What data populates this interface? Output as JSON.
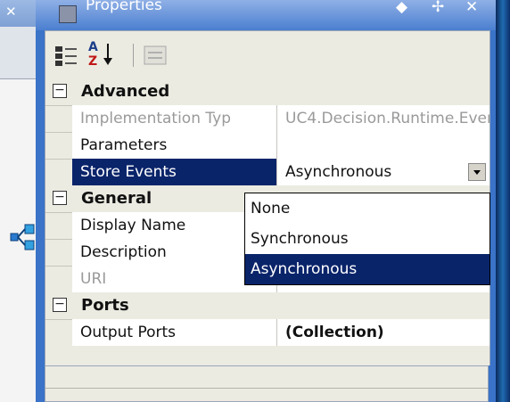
{
  "window": {
    "title": "Properties",
    "pin_glyph": "◆",
    "dock_glyph": "✢",
    "close_glyph": "✕"
  },
  "background_window": {
    "close_glyph": "✕"
  },
  "toolbar": {
    "sort_alpha_letters": [
      "A",
      "Z"
    ]
  },
  "categories": {
    "advanced": {
      "label": "Advanced",
      "expander": "⊟"
    },
    "general": {
      "label": "General",
      "expander": "⊟"
    },
    "ports": {
      "label": "Ports",
      "expander": "⊟"
    }
  },
  "properties": {
    "implementation_type": {
      "name": "Implementation Typ",
      "value": "UC4.Decision.Runtime.Ever"
    },
    "parameters": {
      "name": "Parameters",
      "value": ""
    },
    "store_events": {
      "name": "Store Events",
      "value": "Asynchronous"
    },
    "display_name": {
      "name": "Display Name",
      "value": ""
    },
    "description": {
      "name": "Description",
      "value": ""
    },
    "uri": {
      "name": "URI",
      "value": ""
    },
    "output_ports": {
      "name": "Output Ports",
      "value": "(Collection)"
    }
  },
  "dropdown": {
    "options": [
      "None",
      "Synchronous",
      "Asynchronous"
    ],
    "selected": "Asynchronous"
  },
  "colors": {
    "selection": "#0a246a",
    "window_frame": "#3a73c8",
    "grid_background": "#ecebe2"
  }
}
